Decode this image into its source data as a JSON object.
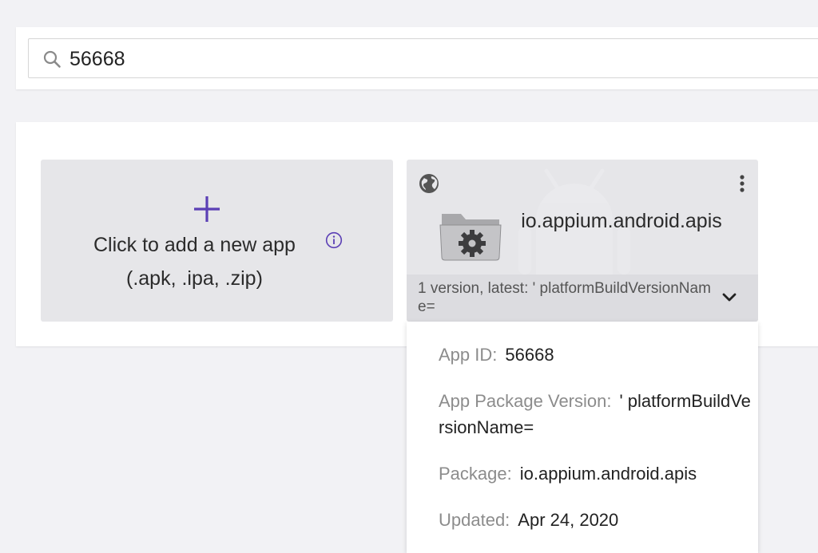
{
  "search": {
    "value": "56668",
    "icon": "search-icon"
  },
  "add_app": {
    "title": "Click to add a new app",
    "subtitle": "(.apk, .ipa, .zip)",
    "plus_icon": "plus-icon",
    "info_icon": "info-icon",
    "accent_color": "#5b3fb5"
  },
  "app": {
    "name": "io.appium.android.apis",
    "version_summary": "1 version, latest: ' platformBuildVersionName=",
    "public_icon": "globe-icon",
    "menu_icon": "kebab-menu-icon",
    "app_icon": "folder-gear-icon",
    "expand_icon": "chevron-down-icon"
  },
  "details": {
    "app_id_label": "App ID:",
    "app_id_value": "56668",
    "package_version_label": "App Package Version:",
    "package_version_value": "' platformBuildVersionName=",
    "package_label": "Package:",
    "package_value": "io.appium.android.apis",
    "updated_label": "Updated:",
    "updated_value": "Apr 24, 2020"
  }
}
